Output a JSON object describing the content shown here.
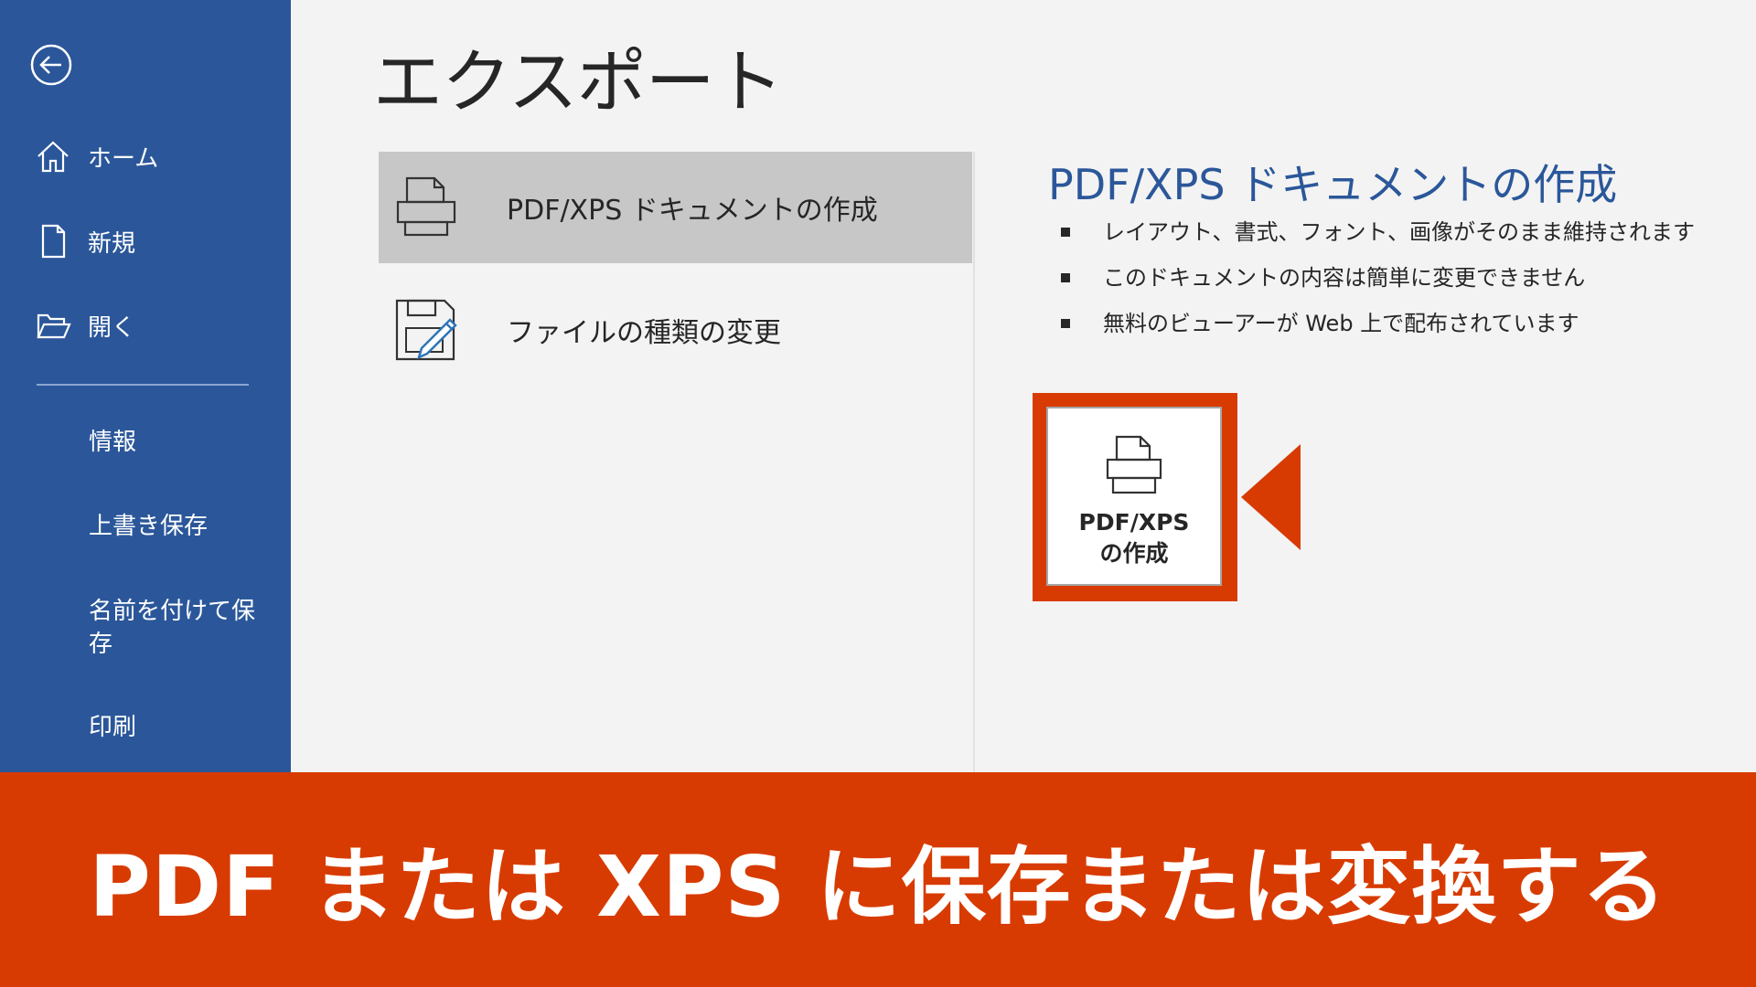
{
  "sidebar": {
    "back_icon": "arrow-left-circle-icon",
    "items_with_icons": [
      {
        "label": "ホーム",
        "icon": "home-icon"
      },
      {
        "label": "新規",
        "icon": "new-document-icon"
      },
      {
        "label": "開く",
        "icon": "folder-open-icon"
      }
    ],
    "items": [
      {
        "label": "情報"
      },
      {
        "label": "上書き保存"
      },
      {
        "label": "名前を付けて保存"
      },
      {
        "label": "印刷"
      }
    ]
  },
  "main": {
    "title": "エクスポート",
    "export_options": [
      {
        "label": "PDF/XPS ドキュメントの作成",
        "icon": "pdf-document-icon",
        "selected": true
      },
      {
        "label": "ファイルの種類の変更",
        "icon": "change-file-type-icon",
        "selected": false
      }
    ]
  },
  "detail": {
    "title": "PDF/XPS ドキュメントの作成",
    "bullets": [
      "レイアウト、書式、フォント、画像がそのまま維持されます",
      "このドキュメントの内容は簡単に変更できません",
      "無料のビューアーが Web 上で配布されています"
    ],
    "create_button": {
      "line1": "PDF/XPS",
      "line2": "の作成",
      "icon": "pdf-document-icon"
    }
  },
  "banner": {
    "text": "PDF または XPS に保存または変換する"
  },
  "colors": {
    "sidebar": "#2b579a",
    "accent": "#d83b01",
    "selected": "#c7c7c7",
    "background": "#f3f3f3"
  }
}
